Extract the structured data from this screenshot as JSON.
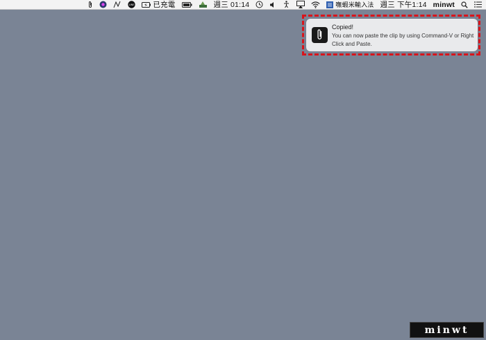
{
  "menubar": {
    "charging_label": "已充電",
    "clock1": "週三 01:14",
    "input_method": "嘸蝦米輸入法",
    "clock2": "週三 下午1:14",
    "user": "minwt"
  },
  "notification": {
    "title": "Copied!",
    "body": "You can now paste the clip by using Command-V or Right Click and Paste."
  },
  "watermark": {
    "text": "minwt"
  },
  "colors": {
    "desktop": "#7a8495",
    "highlight": "#d9141b",
    "menubar": "#f3f3f3"
  }
}
